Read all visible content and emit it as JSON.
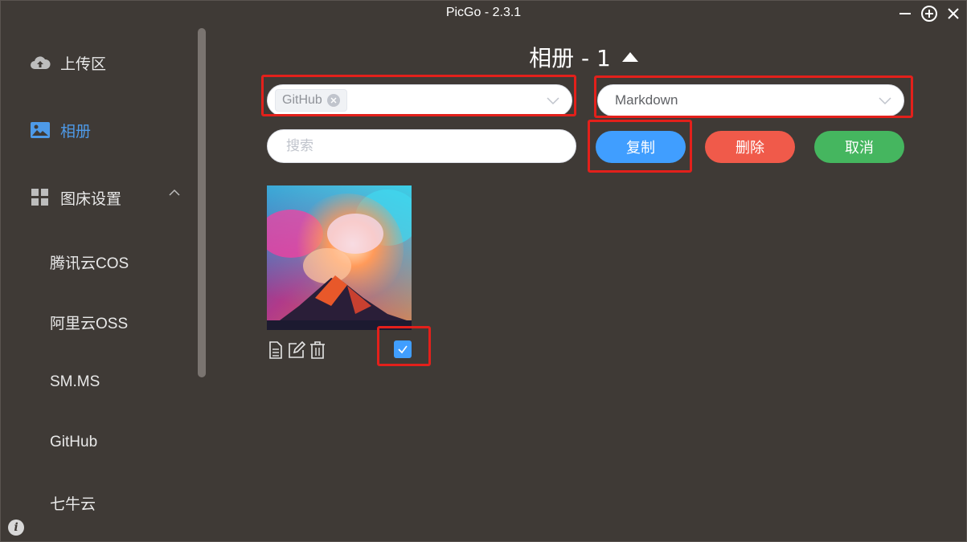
{
  "window": {
    "title": "PicGo - 2.3.1"
  },
  "sidebar": {
    "items": [
      {
        "label": "上传区",
        "icon": "cloud-upload-icon"
      },
      {
        "label": "相册",
        "icon": "image-icon",
        "active": true
      },
      {
        "label": "图床设置",
        "icon": "grid-icon",
        "expanded": true
      }
    ],
    "sub_items": [
      "腾讯云COS",
      "阿里云OSS",
      "SM.MS",
      "GitHub",
      "七牛云"
    ]
  },
  "main": {
    "album_title": "相册 - 1",
    "uploader_filter": {
      "tag": "GitHub"
    },
    "format_select": {
      "value": "Markdown"
    },
    "search": {
      "placeholder": "搜索"
    },
    "buttons": {
      "copy": "复制",
      "delete": "删除",
      "cancel": "取消"
    },
    "gallery": [
      {
        "selected": true
      }
    ]
  },
  "colors": {
    "background": "#3f3a36",
    "accent": "#409eff",
    "danger": "#f05a4a",
    "success": "#45b65f",
    "highlight": "#e3201b"
  }
}
